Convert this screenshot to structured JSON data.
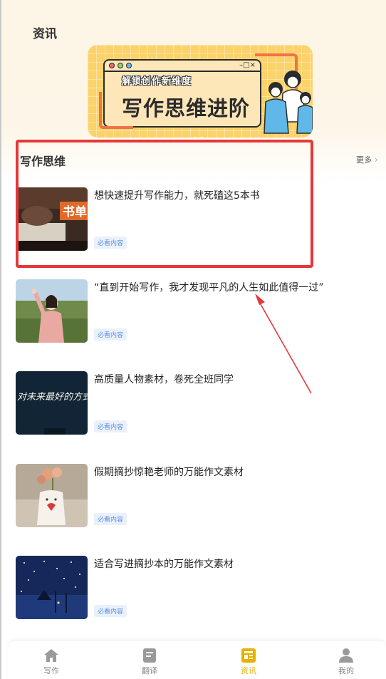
{
  "page": {
    "title": "资讯"
  },
  "banner": {
    "subtitle": "解锁创作新维度",
    "title": "写作思维进阶",
    "window_controls": "–□×"
  },
  "section": {
    "title": "写作思维",
    "more": "更多"
  },
  "articles": [
    {
      "title": "想快速提升写作能力，就死磕这5本书",
      "tag": "必看内容",
      "thumb_text": "书单"
    },
    {
      "title": "“直到开始写作，我才发现平凡的人生如此值得一过”",
      "tag": "必看内容"
    },
    {
      "title": "高质量人物素材，卷死全班同学",
      "tag": "必看内容",
      "thumb_text": "对未来最好的方式 是亲手创造未来"
    },
    {
      "title": "假期摘抄惊艳老师的万能作文素材",
      "tag": "必看内容"
    },
    {
      "title": "适合写进摘抄本的万能作文素材",
      "tag": "必看内容"
    }
  ],
  "nav": {
    "items": [
      {
        "label": "写作",
        "icon": "home-icon"
      },
      {
        "label": "翻译",
        "icon": "translate-icon"
      },
      {
        "label": "资讯",
        "icon": "news-icon",
        "active": true
      },
      {
        "label": "我的",
        "icon": "person-icon"
      }
    ]
  },
  "colors": {
    "accent": "#e6b000",
    "annotation": "#e3383a",
    "tag_text": "#5f8fe0",
    "tag_bg": "#eaf1fd"
  }
}
